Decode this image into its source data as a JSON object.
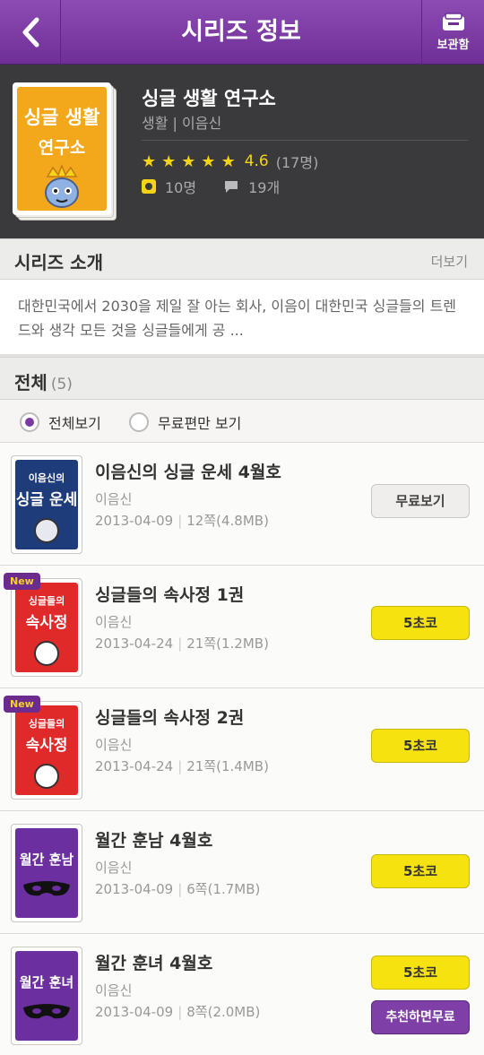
{
  "header": {
    "title": "시리즈 정보",
    "locker_label": "보관함"
  },
  "series": {
    "cover_line1": "싱글 생활",
    "cover_line2": "연구소",
    "title": "싱글 생활 연구소",
    "meta": "생활 | 이음신",
    "rating": "4.6",
    "rating_count": "(17명)",
    "subscribers": "10명",
    "comments": "19개"
  },
  "intro": {
    "title": "시리즈 소개",
    "more": "더보기",
    "text": "대한민국에서 2030을 제일 잘 아는 회사, 이음이 대한민국 싱글들의 트렌드와 생각 모든 것을 싱글들에게 공 ..."
  },
  "all": {
    "title": "전체",
    "count": "(5)"
  },
  "filter": {
    "all_label": "전체보기",
    "free_label": "무료편만 보기"
  },
  "items": [
    {
      "title": "이음신의 싱글 운세 4월호",
      "author": "이음신",
      "date": "2013-04-09",
      "size": "12쪽(4.8MB)",
      "button": "무료보기",
      "thumb_l1": "이음신의",
      "thumb_l2": "싱글 운세"
    },
    {
      "title": "싱글들의 속사정 1권",
      "author": "이음신",
      "date": "2013-04-24",
      "size": "21쪽(1.2MB)",
      "button": "5초코",
      "thumb_l1": "싱글들의",
      "thumb_l2": "속사정",
      "badge": "New"
    },
    {
      "title": "싱글들의 속사정 2권",
      "author": "이음신",
      "date": "2013-04-24",
      "size": "21쪽(1.4MB)",
      "button": "5초코",
      "thumb_l1": "싱글들의",
      "thumb_l2": "속사정",
      "badge": "New"
    },
    {
      "title": "월간 훈남 4월호",
      "author": "이음신",
      "date": "2013-04-09",
      "size": "6쪽(1.7MB)",
      "button": "5초코",
      "thumb_l1": "",
      "thumb_l2": "월간 훈남"
    },
    {
      "title": "월간 훈녀 4월호",
      "author": "이음신",
      "date": "2013-04-09",
      "size": "8쪽(2.0MB)",
      "button": "5초코",
      "button2": "추천하면무료",
      "thumb_l1": "",
      "thumb_l2": "월간 훈녀"
    }
  ],
  "colors": {
    "header": "#7a3aa3",
    "choco_button": "#f5e20e",
    "rating_star": "#f5d414"
  }
}
